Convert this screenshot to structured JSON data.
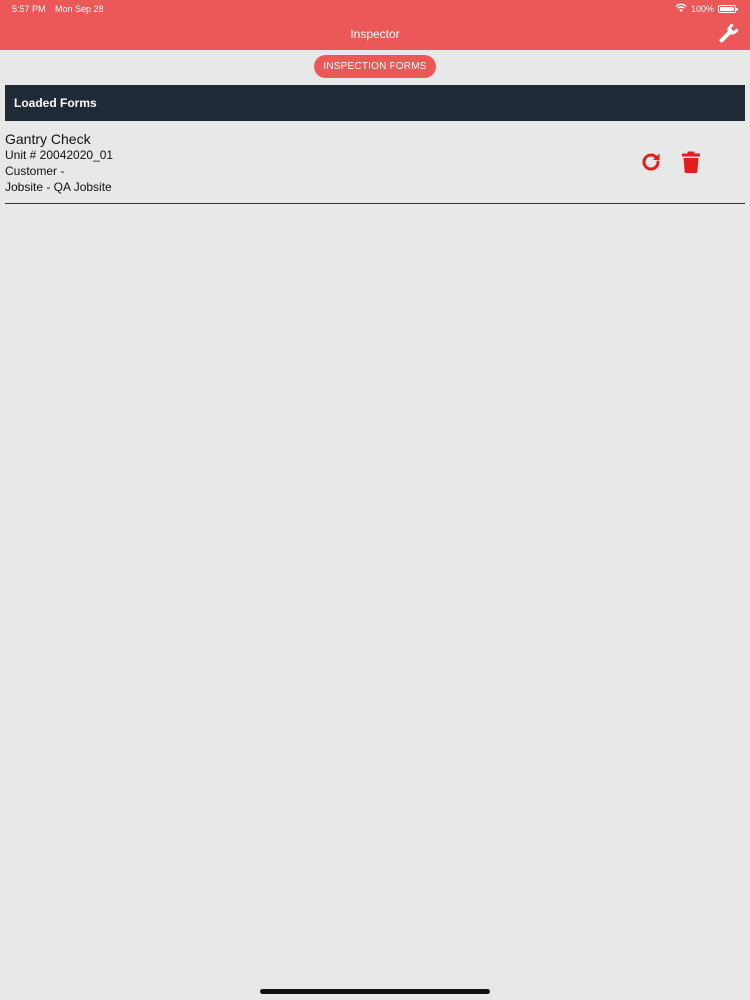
{
  "status_bar": {
    "time": "5:57 PM",
    "date": "Mon Sep 28",
    "battery": "100%"
  },
  "header": {
    "title": "Inspector",
    "settings_icon": "wrench-icon"
  },
  "tabs": {
    "active": "INSPECTION FORMS"
  },
  "section": {
    "title": "Loaded Forms"
  },
  "forms": [
    {
      "title": "Gantry Check",
      "unit": "Unit # 20042020_01",
      "customer": "Customer -",
      "jobsite": "Jobsite - QA Jobsite",
      "actions": [
        "reload-icon",
        "trash-icon"
      ]
    }
  ],
  "colors": {
    "accent": "#ec5858",
    "header_dark": "#1f2a36",
    "action_red": "#e31c1c",
    "background": "#e8e8e8"
  }
}
